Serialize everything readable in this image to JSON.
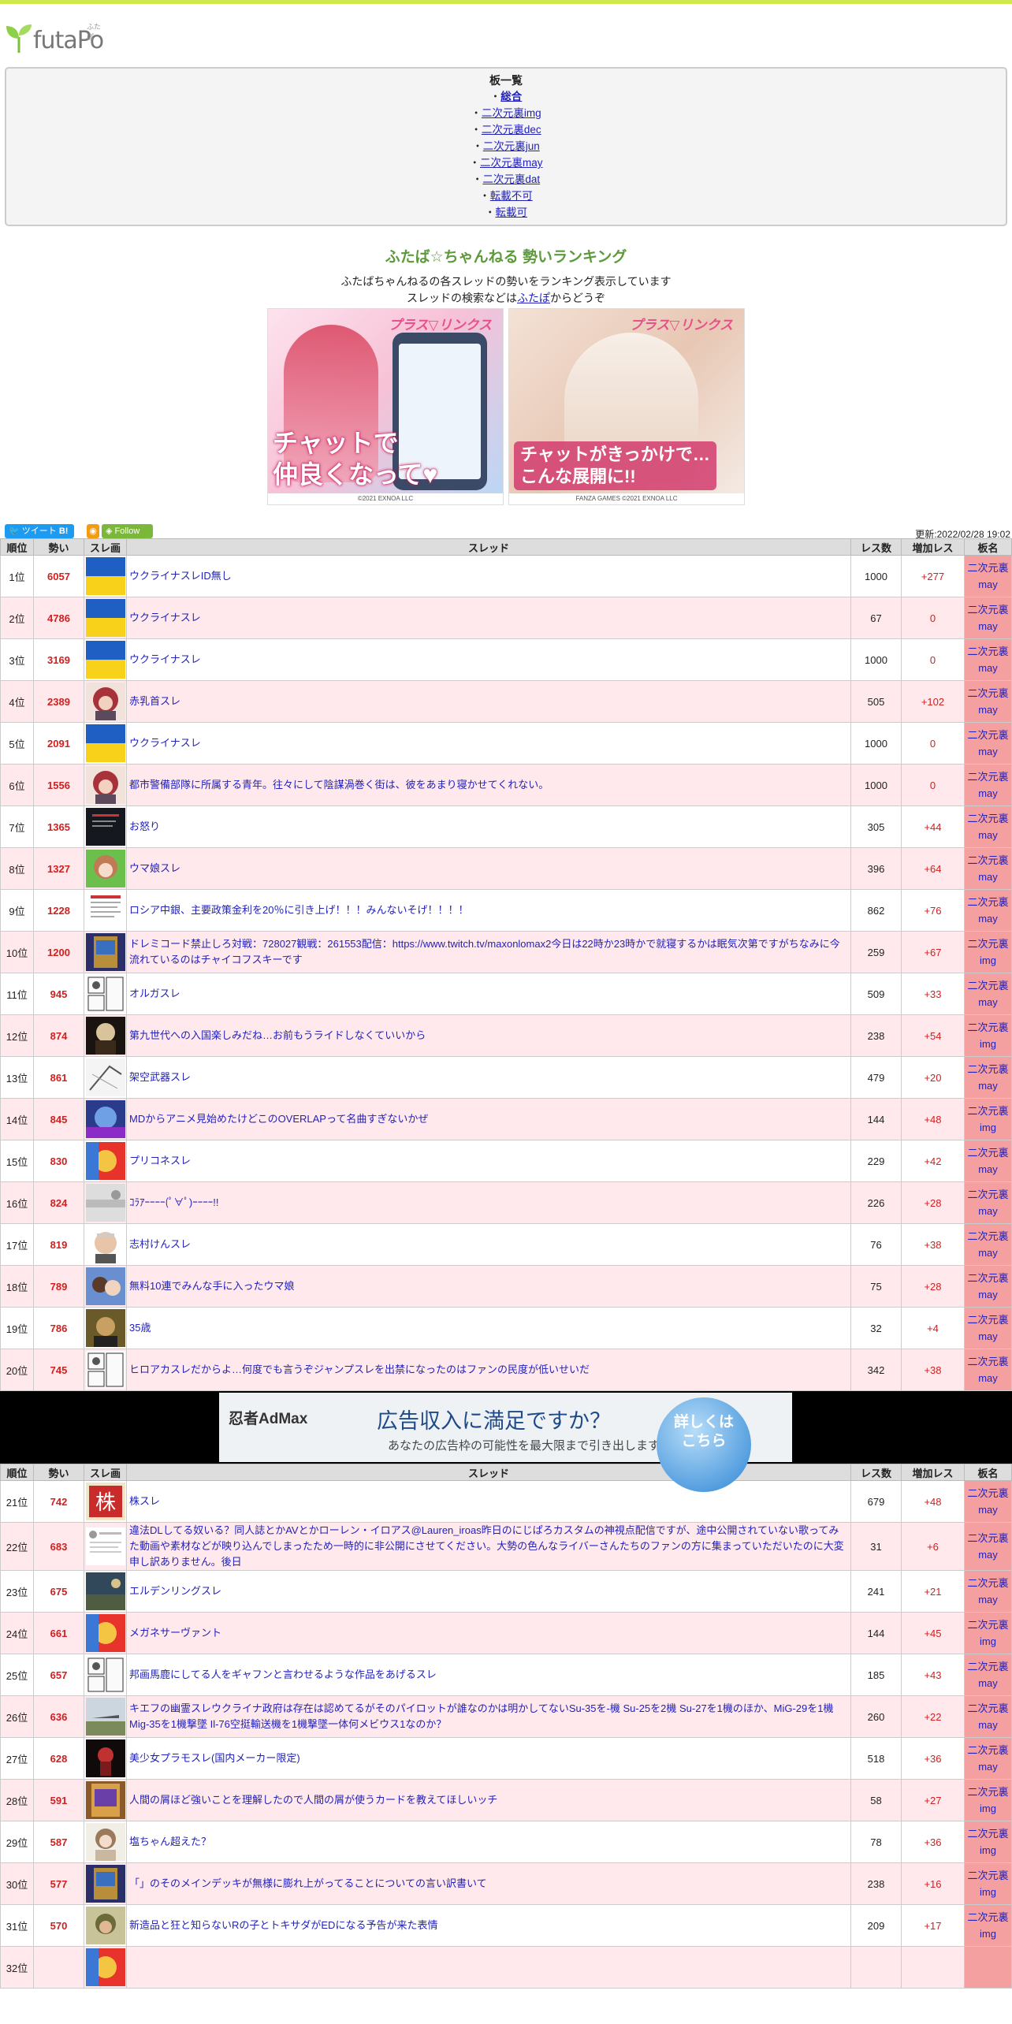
{
  "header": {
    "logo": "futaPo",
    "logo_ruby": "ふたぽ"
  },
  "boards_panel": {
    "title": "板一覧",
    "items": [
      {
        "label": "総合",
        "bold": true
      },
      {
        "label": "二次元裏img"
      },
      {
        "label": "二次元裏dec"
      },
      {
        "label": "二次元裏jun"
      },
      {
        "label": "二次元裏may"
      },
      {
        "label": "二次元裏dat"
      },
      {
        "label": "転載不可"
      },
      {
        "label": "転載可"
      }
    ]
  },
  "intro": {
    "title": "ふたば☆ちゃんねる 勢いランキング",
    "line1": "ふたばちゃんねるの各スレッドの勢いをランキング表示しています",
    "line2_pre": "スレッドの検索などは",
    "line2_link": "ふたぽ",
    "line2_post": "からどうぞ"
  },
  "ads": {
    "left": {
      "logo": "プラス▽リンクス",
      "caption_1": "チャットで",
      "caption_2": "仲良くなって♥",
      "footer": "©2021 EXNOA LLC"
    },
    "right": {
      "logo": "プラス▽リンクス",
      "caption_1": "チャットがきっかけで…",
      "caption_2": "こんな展開に!!",
      "footer": "FANZA GAMES ©2021 EXNOA LLC"
    }
  },
  "social": {
    "tweet": "ツイート",
    "bookmark": "B!",
    "follow": "Follow",
    "updated": "更新:2022/02/28 19:02"
  },
  "table_headers": [
    "順位",
    "勢い",
    "スレ画",
    "スレッド",
    "レス数",
    "増加レス",
    "板名"
  ],
  "admax": {
    "logo": "忍者AdMax",
    "title": "広告収入に満足ですか？",
    "sub": "あなたの広告枠の可能性を最大限まで引き出します",
    "button": "詳しくは\nこちら"
  },
  "rows_a": [
    {
      "rank": "1位",
      "ikioi": "6057",
      "title": "ウクライナスレID無し",
      "res": "1000",
      "inc": "+277",
      "board": "二次元裏may",
      "thumb": "flag"
    },
    {
      "rank": "2位",
      "ikioi": "4786",
      "title": "ウクライナスレ",
      "res": "67",
      "inc": "0",
      "board": "二次元裏may",
      "thumb": "flag"
    },
    {
      "rank": "3位",
      "ikioi": "3169",
      "title": "ウクライナスレ",
      "res": "1000",
      "inc": "0",
      "board": "二次元裏may",
      "thumb": "flag"
    },
    {
      "rank": "4位",
      "ikioi": "2389",
      "title": "赤乳首スレ",
      "res": "505",
      "inc": "+102",
      "board": "二次元裏may",
      "thumb": "redhair"
    },
    {
      "rank": "5位",
      "ikioi": "2091",
      "title": "ウクライナスレ",
      "res": "1000",
      "inc": "0",
      "board": "二次元裏may",
      "thumb": "flag"
    },
    {
      "rank": "6位",
      "ikioi": "1556",
      "title": "都市警備部隊に所属する青年。往々にして陰謀渦巻く街は、彼をあまり寝かせてくれない。",
      "res": "1000",
      "inc": "0",
      "board": "二次元裏may",
      "thumb": "redhair"
    },
    {
      "rank": "7位",
      "ikioi": "1365",
      "title": "お怒り",
      "res": "305",
      "inc": "+44",
      "board": "二次元裏may",
      "thumb": "dark"
    },
    {
      "rank": "8位",
      "ikioi": "1327",
      "title": "ウマ娘スレ",
      "res": "396",
      "inc": "+64",
      "board": "二次元裏may",
      "thumb": "green"
    },
    {
      "rank": "9位",
      "ikioi": "1228",
      "title": "ロシア中銀、主要政策金利を20％に引き上げ！！！みんないそげ！！！！",
      "res": "862",
      "inc": "+76",
      "board": "二次元裏may",
      "thumb": "doc"
    },
    {
      "rank": "10位",
      "ikioi": "1200",
      "title": "ドレミコード禁止しろ対戦：728027観戦：261553配信：https://www.twitch.tv/maxonlomax2今日は22時か23時かで就寝するかは眠気次第ですがちなみに今流れているのはチャイコフスキーです",
      "res": "259",
      "inc": "+67",
      "board": "二次元裏img",
      "thumb": "card"
    },
    {
      "rank": "11位",
      "ikioi": "945",
      "title": "オルガスレ",
      "res": "509",
      "inc": "+33",
      "board": "二次元裏may",
      "thumb": "manga"
    },
    {
      "rank": "12位",
      "ikioi": "874",
      "title": "第九世代への入国楽しみだね…お前もうライドしなくていいから",
      "res": "238",
      "inc": "+54",
      "board": "二次元裏img",
      "thumb": "darkchar"
    },
    {
      "rank": "13位",
      "ikioi": "861",
      "title": "架空武器スレ",
      "res": "479",
      "inc": "+20",
      "board": "二次元裏may",
      "thumb": "sketch"
    },
    {
      "rank": "14位",
      "ikioi": "845",
      "title": "MDからアニメ見始めたけどこのOVERLAPって名曲すぎないかぜ",
      "res": "144",
      "inc": "+48",
      "board": "二次元裏img",
      "thumb": "blue"
    },
    {
      "rank": "15位",
      "ikioi": "830",
      "title": "プリコネスレ",
      "res": "229",
      "inc": "+42",
      "board": "二次元裏may",
      "thumb": "colorful"
    },
    {
      "rank": "16位",
      "ikioi": "824",
      "title": "ｺﾗｱｰｰｰｰ(ﾟ∀ﾟ)ｰｰｰｰ!!",
      "res": "226",
      "inc": "+28",
      "board": "二次元裏may",
      "thumb": "grey"
    },
    {
      "rank": "17位",
      "ikioi": "819",
      "title": "志村けんスレ",
      "res": "76",
      "inc": "+38",
      "board": "二次元裏may",
      "thumb": "face"
    },
    {
      "rank": "18位",
      "ikioi": "789",
      "title": "無料10連でみんな手に入ったウマ娘",
      "res": "75",
      "inc": "+28",
      "board": "二次元裏may",
      "thumb": "anime"
    },
    {
      "rank": "19位",
      "ikioi": "786",
      "title": "35歳",
      "res": "32",
      "inc": "+4",
      "board": "二次元裏may",
      "thumb": "olive"
    },
    {
      "rank": "20位",
      "ikioi": "745",
      "title": "ヒロアカスレだからよ…何度でも言うぞジャンプスレを出禁になったのはファンの民度が低いせいだ",
      "res": "342",
      "inc": "+38",
      "board": "二次元裏may",
      "thumb": "manga"
    }
  ],
  "rows_b": [
    {
      "rank": "21位",
      "ikioi": "742",
      "title": "株スレ",
      "res": "679",
      "inc": "+48",
      "board": "二次元裏may",
      "thumb": "kabu"
    },
    {
      "rank": "22位",
      "ikioi": "683",
      "title": "違法DLしてる奴いる？同人誌とかAVとかローレン・イロアス@Lauren_iroas昨日のにじぱろカスタムの神視点配信ですが、途中公開されていない歌ってみた動画や素材などが映り込んでしまったため一時的に非公開にさせてください。大勢の色んなライバーさんたちのファンの方に集まっていただいたのに大変申し訳ありません。後日",
      "res": "31",
      "inc": "+6",
      "board": "二次元裏may",
      "thumb": "tweet"
    },
    {
      "rank": "23位",
      "ikioi": "675",
      "title": "エルデンリングスレ",
      "res": "241",
      "inc": "+21",
      "board": "二次元裏may",
      "thumb": "landscape"
    },
    {
      "rank": "24位",
      "ikioi": "661",
      "title": "メガネサーヴァント",
      "res": "144",
      "inc": "+45",
      "board": "二次元裏img",
      "thumb": "colorful"
    },
    {
      "rank": "25位",
      "ikioi": "657",
      "title": "邦画馬鹿にしてる人をギャフンと言わせるような作品をあげるスレ",
      "res": "185",
      "inc": "+43",
      "board": "二次元裏may",
      "thumb": "manga"
    },
    {
      "rank": "26位",
      "ikioi": "636",
      "title": "キエフの幽霊スレウクライナ政府は存在は認めてるがそのパイロットが誰なのかは明かしてないSu-35を-機 Su-25を2機 Su-27を1機のほか、MiG-29を1機 Mig-35を1機撃墜 Il-76空挺輸送機を1機撃墜一体何メビウス1なのか？",
      "res": "260",
      "inc": "+22",
      "board": "二次元裏may",
      "thumb": "plane"
    },
    {
      "rank": "27位",
      "ikioi": "628",
      "title": "美少女プラモスレ(国内メーカー限定)",
      "res": "518",
      "inc": "+36",
      "board": "二次元裏may",
      "thumb": "darkred"
    },
    {
      "rank": "28位",
      "ikioi": "591",
      "title": "人間の屑ほど強いことを理解したので人間の屑が使うカードを教えてほしいッチ",
      "res": "58",
      "inc": "+27",
      "board": "二次元裏img",
      "thumb": "yugioh"
    },
    {
      "rank": "29位",
      "ikioi": "587",
      "title": "塩ちゃん超えた？",
      "res": "78",
      "inc": "+36",
      "board": "二次元裏img",
      "thumb": "girl"
    },
    {
      "rank": "30位",
      "ikioi": "577",
      "title": "「」のそのメインデッキが無様に膨れ上がってることについての言い訳書いて",
      "res": "238",
      "inc": "+16",
      "board": "二次元裏img",
      "thumb": "card"
    },
    {
      "rank": "31位",
      "ikioi": "570",
      "title": "新造品と狂と知らないRの子とトキサダがEDになる予告が来た表情",
      "res": "209",
      "inc": "+17",
      "board": "二次元裏img",
      "thumb": "soldier"
    },
    {
      "rank": "32位",
      "ikioi": "",
      "title": "",
      "res": "",
      "inc": "",
      "board": "",
      "thumb": "colorful"
    }
  ]
}
